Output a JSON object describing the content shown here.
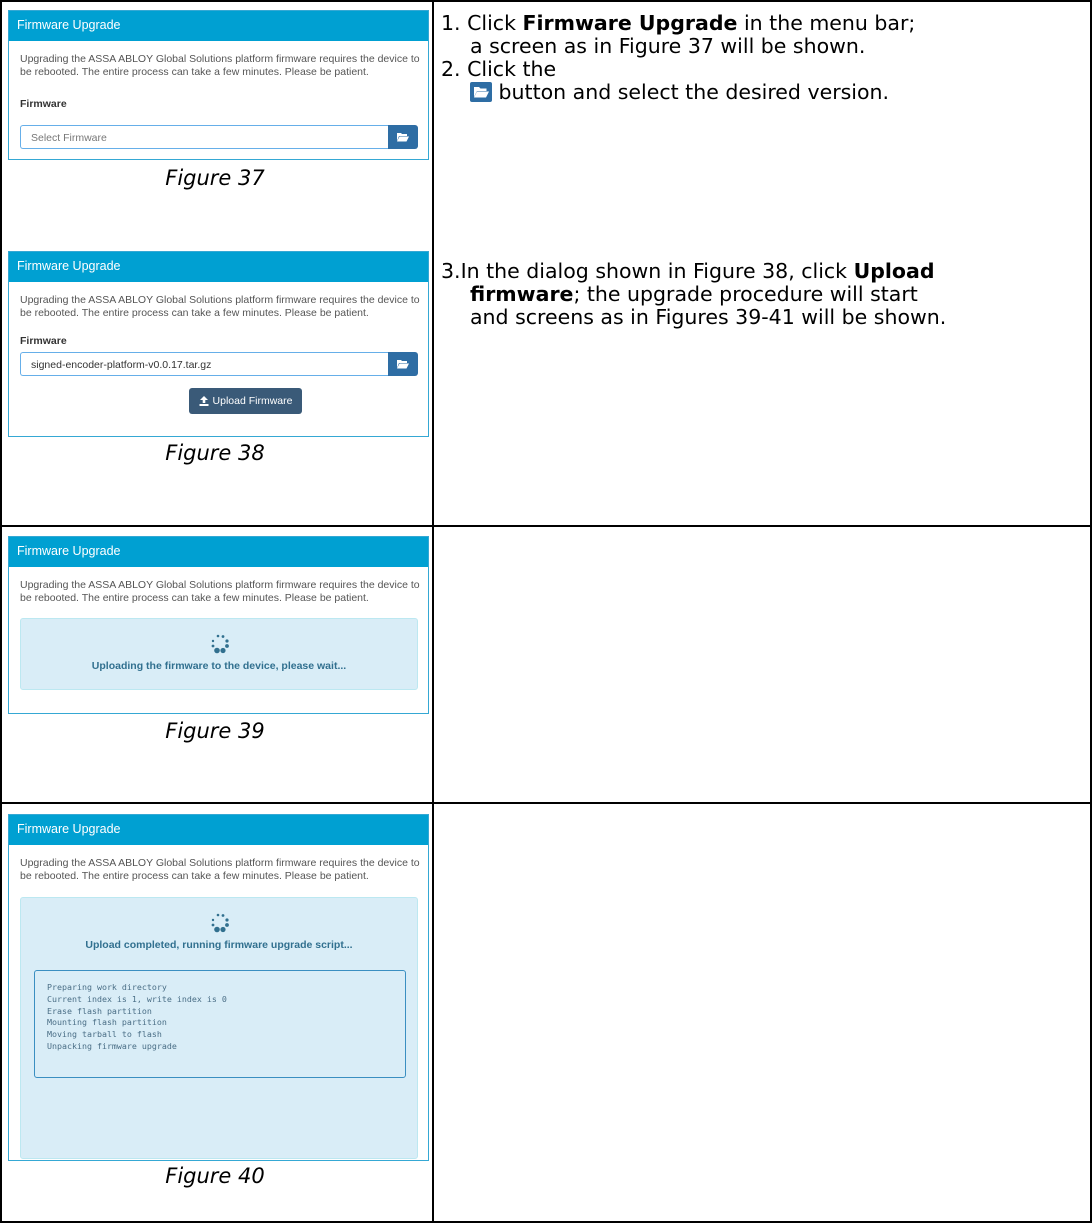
{
  "panel_common": {
    "title": "Firmware Upgrade",
    "description": "Upgrading the ASSA ABLOY Global Solutions platform firmware requires the device to be rebooted. The entire process can take a few minutes. Please be patient.",
    "field_label": "Firmware"
  },
  "figure37": {
    "placeholder": "Select Firmware",
    "caption": "Figure 37"
  },
  "figure38": {
    "file_value": "signed-encoder-platform-v0.0.17.tar.gz",
    "upload_button": "Upload Firmware",
    "caption": "Figure 38"
  },
  "figure39": {
    "status": "Uploading the firmware to the device, please wait...",
    "caption": "Figure 39"
  },
  "figure40": {
    "status": "Upload completed, running firmware upgrade script...",
    "log_lines": [
      "Preparing work directory",
      "Current index is 1, write index is 0",
      "Erase flash partition",
      "Mounting flash partition",
      "Moving tarball to flash",
      "Unpacking firmware upgrade"
    ],
    "caption": "Figure 40"
  },
  "instructions": {
    "step1_num": "1.",
    "step1_pre": "Click",
    "step1_bold": "Firmware Upgrade",
    "step1_post": "in the menu bar;",
    "step1_line2": "a screen as in Figure 37 will be shown.",
    "step2_num": "2.",
    "step2_pre": "Click the",
    "step2_post": "button and select the desired version.",
    "step3_num": "3.",
    "step3_pre": "In the dialog shown in Figure 38, click",
    "step3_bold1": "Upload",
    "step3_bold2": "firmware",
    "step3_post": "; the upgrade procedure will start",
    "step3_line3": "and screens as in Figures 39-41 will be shown."
  },
  "colors": {
    "panel_header": "#00a0d2",
    "button_blue": "#2e6da4",
    "upload_button": "#3a5a78",
    "info_bg": "#d9edf7",
    "info_text": "#31708f"
  },
  "icons": {
    "browse": "folder-open-icon",
    "upload": "upload-icon",
    "spinner": "loading-spinner-icon"
  }
}
